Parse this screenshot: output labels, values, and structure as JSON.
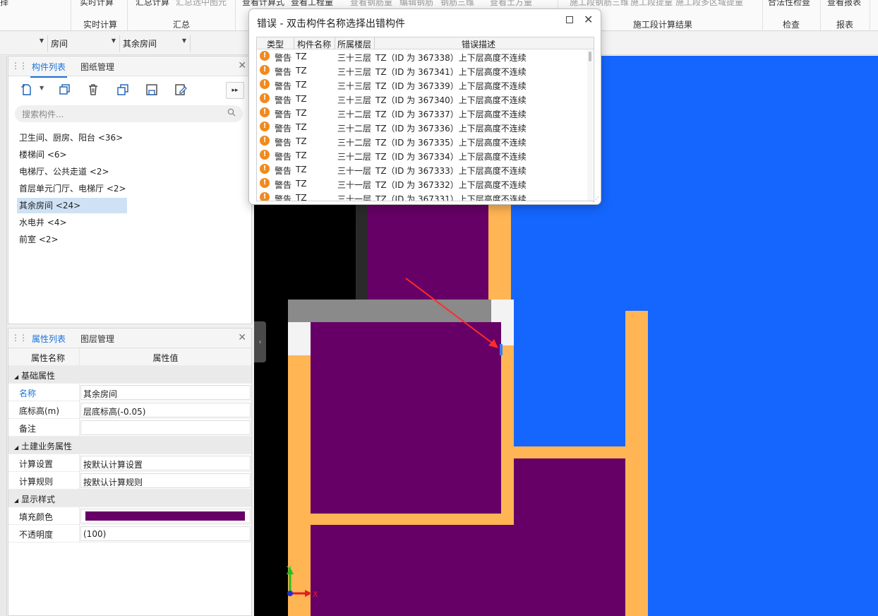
{
  "ribbon": {
    "top_texts": [
      "择",
      "实时计算",
      "汇总计算",
      "汇总选中图元",
      "查看计算式",
      "查看工程量",
      "查看钢筋量",
      "编辑钢筋",
      "钢筋三维",
      "查看土方量",
      "施工段钢筋三维",
      "施工段提量",
      "施工段多区域提量",
      "合法性检查",
      "查看报表"
    ],
    "groups": [
      "实时计算",
      "汇总",
      "施工段计算结果",
      "检查",
      "报表"
    ]
  },
  "filter": {
    "category": "房间",
    "component": "其余房间"
  },
  "comp_panel": {
    "tabs": [
      "构件列表",
      "图纸管理"
    ],
    "search_placeholder": "搜索构件...",
    "items": [
      "卫生间、厨房、阳台 <36>",
      "楼梯间 <6>",
      "电梯厅、公共走道 <2>",
      "首层单元门厅、电梯厅 <2>",
      "其余房间 <24>",
      "水电井 <4>",
      "前室 <2>"
    ],
    "selected_index": 4
  },
  "prop_panel": {
    "tabs": [
      "属性列表",
      "图层管理"
    ],
    "header": {
      "name": "属性名称",
      "value": "属性值"
    },
    "groups": {
      "basic": "基础属性",
      "civil": "土建业务属性",
      "display": "显示样式"
    },
    "rows": {
      "name": {
        "label": "名称",
        "value": "其余房间"
      },
      "elev": {
        "label": "底标高(m)",
        "value": "层底标高(-0.05)"
      },
      "note": {
        "label": "备注",
        "value": ""
      },
      "calc_setting": {
        "label": "计算设置",
        "value": "按默认计算设置"
      },
      "calc_rule": {
        "label": "计算规则",
        "value": "按默认计算规则"
      },
      "fill_color": {
        "label": "填充颜色",
        "value": "#660066"
      },
      "opacity": {
        "label": "不透明度",
        "value": "(100)"
      }
    }
  },
  "dialog": {
    "title": "错误 - 双击构件名称选择出错构件",
    "columns": [
      "类型",
      "构件名称",
      "所属楼层",
      "错误描述"
    ],
    "rows": [
      {
        "type": "警告",
        "name": "TZ",
        "floor": "三十三层",
        "desc": "TZ（ID 为 367338）上下层高度不连续"
      },
      {
        "type": "警告",
        "name": "TZ",
        "floor": "三十三层",
        "desc": "TZ（ID 为 367341）上下层高度不连续"
      },
      {
        "type": "警告",
        "name": "TZ",
        "floor": "三十三层",
        "desc": "TZ（ID 为 367339）上下层高度不连续"
      },
      {
        "type": "警告",
        "name": "TZ",
        "floor": "三十三层",
        "desc": "TZ（ID 为 367340）上下层高度不连续"
      },
      {
        "type": "警告",
        "name": "TZ",
        "floor": "三十二层",
        "desc": "TZ（ID 为 367337）上下层高度不连续"
      },
      {
        "type": "警告",
        "name": "TZ",
        "floor": "三十二层",
        "desc": "TZ（ID 为 367336）上下层高度不连续"
      },
      {
        "type": "警告",
        "name": "TZ",
        "floor": "三十二层",
        "desc": "TZ（ID 为 367335）上下层高度不连续"
      },
      {
        "type": "警告",
        "name": "TZ",
        "floor": "三十二层",
        "desc": "TZ（ID 为 367334）上下层高度不连续"
      },
      {
        "type": "警告",
        "name": "TZ",
        "floor": "三十一层",
        "desc": "TZ（ID 为 367333）上下层高度不连续"
      },
      {
        "type": "警告",
        "name": "TZ",
        "floor": "三十一层",
        "desc": "TZ（ID 为 367332）上下层高度不连续"
      },
      {
        "type": "警告",
        "name": "TZ",
        "floor": "三十一层",
        "desc": "TZ（ID 为 367331）上下层高度不连续"
      }
    ]
  },
  "axes": {
    "x": "X",
    "y": "Y"
  },
  "colors": {
    "room_fill": "#660066",
    "wall": "#ffb554",
    "blue_area": "#1566ff",
    "accent": "#1a73d9",
    "warning": "#f28a1d"
  }
}
